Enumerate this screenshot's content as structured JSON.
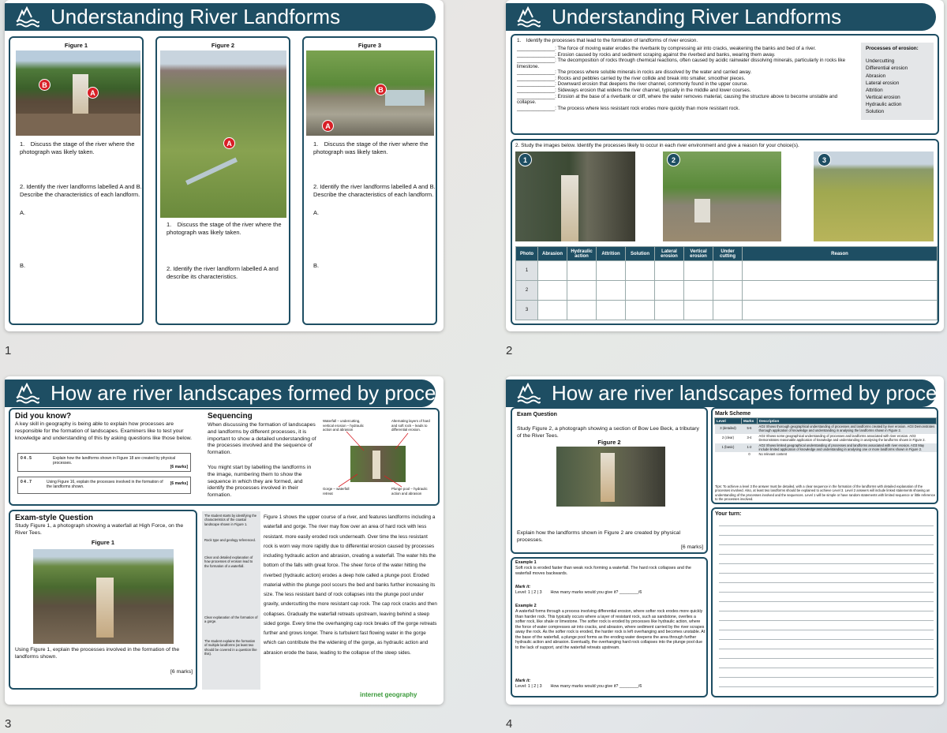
{
  "slides": [
    {
      "number": "1",
      "title": "Understanding River Landforms",
      "figures": [
        {
          "label": "Figure 1",
          "pins": [
            "B",
            "A"
          ],
          "q1": "1. Discuss the stage of the river where the photograph was likely taken.",
          "q2": "2. Identify the river landforms labelled A and B. Describe the characteristics of each landform.",
          "a": "A.",
          "b": "B."
        },
        {
          "label": "Figure 2",
          "pins": [
            "A"
          ],
          "q1": "1. Discuss the stage of the river where the photograph was likely taken.",
          "q2": "2. Identify the river landform labelled A and describe its characteristics."
        },
        {
          "label": "Figure 3",
          "pins": [
            "B",
            "A"
          ],
          "q1": "1. Discuss the stage of the river where the photograph was likely taken.",
          "q2": "2. Identify the river landforms labelled A and B. Describe the characteristics of each landform.",
          "a": "A.",
          "b": "B."
        }
      ]
    },
    {
      "number": "2",
      "title": "Understanding River Landforms",
      "q1_title": "1. Identify the processes that lead to the formation of landforms of river erosion.",
      "definitions": [
        "______________: The force of moving water erodes the riverbank by compressing air into cracks, weakening the banks and bed of a river.",
        "______________: Erosion caused by rocks and sediment scraping against the riverbed and banks, wearing them away.",
        "______________: The decomposition of rocks through chemical reactions, often caused by acidic rainwater dissolving minerals, particularly in rocks like limestone.",
        "______________: The process where soluble minerals in rocks are dissolved by the water and carried away.",
        "______________: Rocks and pebbles carried by the river collide and break into smaller, smoother pieces.",
        "______________: Downward erosion that deepens the river channel, commonly found in the upper course.",
        "______________: Sideways erosion that widens the river channel, typically in the middle and lower courses.",
        "______________: Erosion at the base of a riverbank or cliff, where the water removes material, causing the structure above to become unstable and collapse.",
        "______________: The process where less resistant rock erodes more quickly than more resistant rock."
      ],
      "processes_title": "Processes of erosion:",
      "processes": [
        "Undercutting",
        "Differential erosion",
        "Abrasion",
        "Lateral erosion",
        "Attrition",
        "Vertical erosion",
        "Hydraulic action",
        "Solution"
      ],
      "q2_title": "2. Study the images below. Identify the processes likely to occur in each river environment and give a reason for your choice(s).",
      "images": [
        "1",
        "2",
        "3"
      ],
      "table_headers": [
        "Photo",
        "Abrasion",
        "Hydraulic action",
        "Attrition",
        "Solution",
        "Lateral erosion",
        "Vertical erosion",
        "Under cutting",
        "Reason"
      ],
      "table_rows": [
        "1",
        "2",
        "3"
      ]
    },
    {
      "number": "3",
      "title": "How are river landscapes formed by processes?",
      "did_you_know_title": "Did you know?",
      "did_you_know_text": "A key skill in geography is being able to explain how processes are responsible for the formation of landscapes. Examiners like to test your knowledge and understanding of this by asking questions like those below.",
      "sample_q1_num": "0 4 . 5",
      "sample_q1_text": "Explain how the landforms shown in Figure 18 are created by physical processes.",
      "sample_q1_marks": "[6 marks]",
      "sample_q2_num": "0 4 . 7",
      "sample_q2_text": "Using Figure 16, explain the processes involved in the formation of the landforms shown.",
      "sample_q2_marks": "[6 marks]",
      "sequencing_title": "Sequencing",
      "sequencing_p1": "When discussing the formation of landscapes and landforms by different processes, it is important to show a detailed understanding of the processes involved and the sequence of formation.",
      "sequencing_p2": "You might start by labelling the landforms in the image, numbering them to show the sequence in which they are formed, and identify the processes involved in their formation.",
      "callouts": [
        "Waterfall – undercutting, vertical erosion – hydraulic action and abrasion",
        "Alternating layers of hard and soft rock – leads to differential erosion.",
        "Gorge – waterfall retreat",
        "Plunge pool – hydraulic action and abrasion"
      ],
      "exam_title": "Exam-style Question",
      "exam_intro": "Study Figure 1, a photograph showing a waterfall at High Force, on the River Tees.",
      "exam_fig": "Figure 1",
      "exam_q": "Using Figure 1, explain the processes involved in the formation of the landforms shown.",
      "exam_marks": "[6 marks]",
      "side_notes": [
        "The student starts by identifying the characteristics of the coastal landscape shown in Figure 1.",
        "Rock type and geology referenced.",
        "Clear and detailed explanation of how processes of erosion lead to the formation of a waterfall.",
        "Clear explanation of the formation of a gorge.",
        "The student explains the formation of multiple landforms (at least two should be covered in a question like this)."
      ],
      "answer": "Figure 1 shows  the upper course of a river, and features landforms including a waterfall and gorge. The river may flow over an area of hard rock with less resistant. more easily eroded rock underneath. Over time the less resistant rock is worn way more rapidly due to differential erosion caused by processes including hydraulic action and abrasion, creating a waterfall. The water hits the bottom of the falls with great force. The sheer force of the water hitting the riverbed (hydraulic action) erodes a deep hole called a plunge pool. Eroded material within the plunge pool scours the bed and banks further increasing its size. The less resistant band of rock collapses into the plunge pool under gravity, undercutting the more resistant cap rock. The cap rock cracks and then collapses. Gradually the waterfall retreats upstream, leaving behind a steep sided gorge. Every time the overhanging cap rock breaks off the gorge retreats further and grows longer. There is turbulent fast flowing water in the gorge which can contribute the the widening of the gorge, as hydraulic action and abrasion erode the base, leading to the collapse of the steep sides.",
      "brand": "internet geography"
    },
    {
      "number": "4",
      "title": "How are river landscapes formed by processes?",
      "exam_title": "Exam Question",
      "exam_intro": "Study Figure 2, a photograph showing a section of Bow Lee Beck, a tributary of the River Tees.",
      "fig_label": "Figure 2",
      "exam_q": "Explain how the landforms shown in Figure 2 are created by physical processes.",
      "exam_marks": "[6 marks]",
      "ex1_title": "Example 1",
      "ex1_text": "Soft rock is eroded faster than weak rock forming a waterfall. The hard rock collapses and the waterfall moves backwards.",
      "mark_it": "Mark it:",
      "mark_line": "Level: 1 | 2 | 3  How many marks would you give it? ________/6",
      "ex2_title": "Example 2",
      "ex2_text": "A waterfall forms through a process involving differential erosion, where softer rock erodes more quickly than harder rock. This typically occurs where a layer of resistant rock, such as sandstone, overlies a softer rock, like shale or limestone. The softer rock is eroded by processes like hydraulic action, where the force of water compresses air into cracks, and abrasion, where sediment carried by the river scrapes away the rock. As the softer rock is eroded, the harder rock is left overhanging and becomes unstable. At the base of the waterfall, a plunge pool forms as the eroding water deepens the area through further hydraulic action and abrasion. Eventually, the overhanging hard rock collapses into the plunge pool due to the lack of support, and the waterfall retreats upstream.",
      "ms_title": "Mark Scheme",
      "ms_headers": [
        "Level",
        "Marks",
        "Description"
      ],
      "ms_rows": [
        {
          "level": "3 (detailed)",
          "marks": "5-6",
          "desc": "AO2 Shows thorough geographical understanding of processes and landforms created by river erosion. AO3 Demonstrates thorough application of knowledge and understanding in analysing the landforms shown in Figure 2."
        },
        {
          "level": "2 (clear)",
          "marks": "3-4",
          "desc": "AO2 Shows some geographical understanding of processes and landforms associated with river erosion. AO3 Demonstrates reasonable application of knowledge and understanding in analysing the landforms shown in Figure 2."
        },
        {
          "level": "1 (basic)",
          "marks": "1-2",
          "desc": "AO2 Shows limited geographical understanding of processes and landforms associated with river erosion. AO3 May include limited application of knowledge and understanding in analysing one or more landforms shown in Figure 2."
        },
        {
          "level": "",
          "marks": "0",
          "desc": "No relevant content"
        }
      ],
      "ms_tips": "Tips: To achieve a level 3 the answer must be detailed, with a clear sequence in the formation of the landforms with detailed explanation of the processes involved. Also, at least two landforms should be explained to achieve Level 3. Level 2 answers will include linked statements showing an understanding of the processes involved and the sequences. Level 1 will be simple or have random statements with limited sequence or little reference to the processes involved.",
      "your_turn": "Your turn:"
    }
  ],
  "colors": {
    "banner": "#1e4e63",
    "pin": "#d81f26",
    "border": "#1e4e63"
  }
}
